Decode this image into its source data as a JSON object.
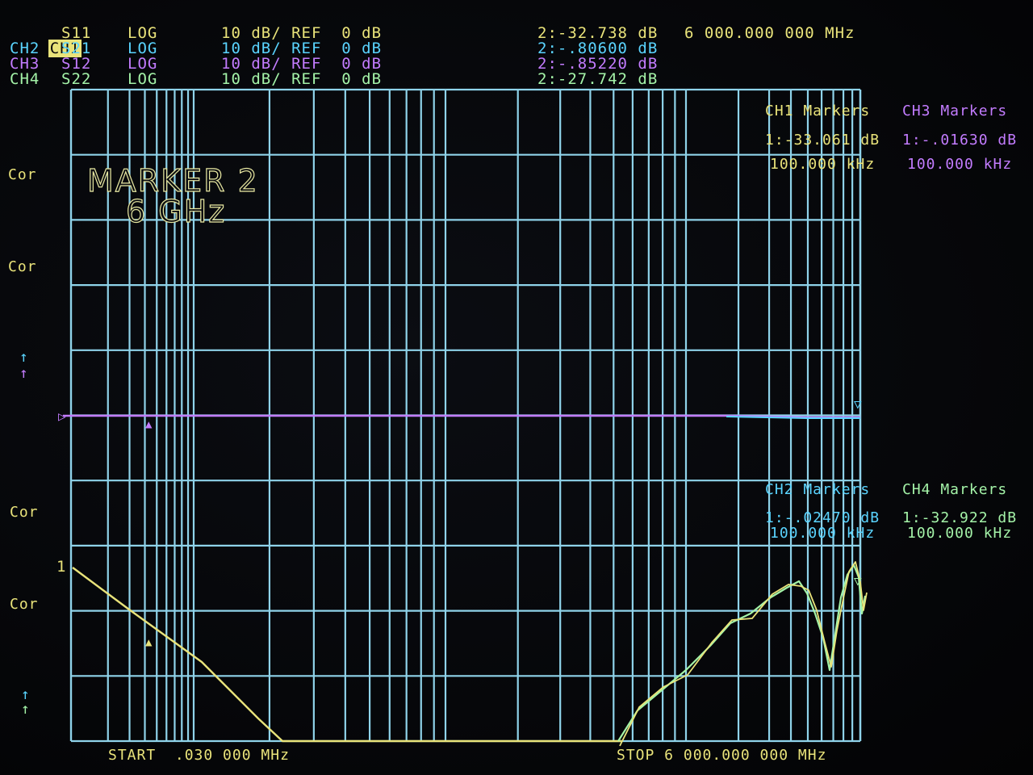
{
  "channels": [
    {
      "label": "CH1",
      "param": "S11",
      "format": "LOG",
      "scale": "10 dB/ REF  0 dB",
      "marker2": "2:-32.738 dB",
      "color": "#e9e37a"
    },
    {
      "label": "CH2",
      "param": "S21",
      "format": "LOG",
      "scale": "10 dB/ REF  0 dB",
      "marker2": "2:-.80600 dB",
      "color": "#5ad4ff"
    },
    {
      "label": "CH3",
      "param": "S12",
      "format": "LOG",
      "scale": "10 dB/ REF  0 dB",
      "marker2": "2:-.85220 dB",
      "color": "#c37cff"
    },
    {
      "label": "CH4",
      "param": "S22",
      "format": "LOG",
      "scale": "10 dB/ REF  0 dB",
      "marker2": "2:-27.742 dB",
      "color": "#a4f3a8"
    }
  ],
  "marker_freq": "6 000.000 000 MHz",
  "side_labels": {
    "cor1": "Cor",
    "cor2": "Cor",
    "cor3": "Cor",
    "cor4": "Cor"
  },
  "annotation": {
    "line1": "MARKER 2",
    "line2": "6 GHz"
  },
  "marker_tables": {
    "ch1": {
      "title": "CH1 Markers",
      "value": "1:-33.061 dB",
      "freq": "100.000 kHz"
    },
    "ch3": {
      "title": "CH3 Markers",
      "value": "1:-.01630 dB",
      "freq": "100.000 kHz"
    },
    "ch2": {
      "title": "CH2 Markers",
      "value": "1:-.02470 dB",
      "freq": "100.000 kHz"
    },
    "ch4": {
      "title": "CH4 Markers",
      "value": "1:-32.922 dB",
      "freq": "100.000 kHz"
    }
  },
  "start": "START  .030 000 MHz",
  "stop": "STOP 6 000.000 000 MHz",
  "ref_marker_label": "1",
  "colors": {
    "grid": "#8fd3ea",
    "ch1": "#e9e37a",
    "ch2": "#5ad4ff",
    "ch3": "#c37cff",
    "ch4": "#a4f3a8"
  }
}
